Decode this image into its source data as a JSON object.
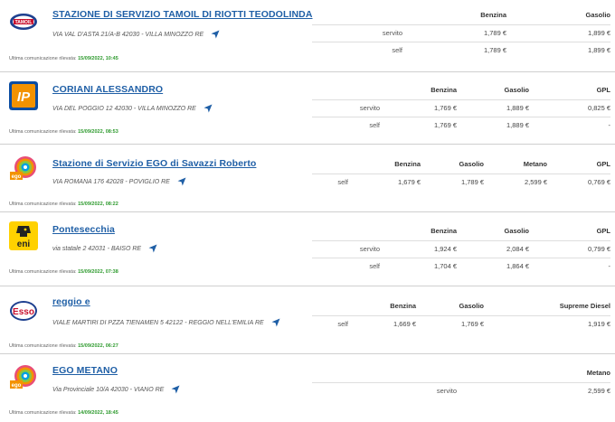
{
  "labels": {
    "last_update": "Ultima comunicazione rilevata:"
  },
  "stations": [
    {
      "name": "STAZIONE DI SERVIZIO TAMOIL DI RIOTTI TEODOLINDA",
      "address": "VIA VAL D'ASTA 21/A-B 42030 - VILLA MINOZZO RE",
      "brand_icon": "tamoil-logo-icon",
      "last_update": "15/09/2022, 10:45",
      "fuels": [
        "Benzina",
        "Gasolio"
      ],
      "rows": [
        {
          "service": "servito",
          "prices": [
            "1,789 €",
            "1,899 €"
          ]
        },
        {
          "service": "self",
          "prices": [
            "1,789 €",
            "1,899 €"
          ]
        }
      ]
    },
    {
      "name": "CORIANI ALESSANDRO",
      "address": "VIA DEL POGGIO 12 42030 - VILLA MINOZZO RE",
      "brand_icon": "ip-logo-icon",
      "last_update": "15/09/2022, 08:53",
      "fuels": [
        "Benzina",
        "Gasolio",
        "GPL"
      ],
      "rows": [
        {
          "service": "servito",
          "prices": [
            "1,769 €",
            "1,889 €",
            "0,825 €"
          ]
        },
        {
          "service": "self",
          "prices": [
            "1,769 €",
            "1,889 €",
            "-"
          ]
        }
      ]
    },
    {
      "name": "Stazione di Servizio EGO di Savazzi Roberto",
      "address": "VIA ROMANA 176 42028 - POVIGLIO RE",
      "brand_icon": "ego-logo-icon",
      "last_update": "15/09/2022, 08:22",
      "fuels": [
        "Benzina",
        "Gasolio",
        "Metano",
        "GPL"
      ],
      "rows": [
        {
          "service": "self",
          "prices": [
            "1,679 €",
            "1,789 €",
            "2,599 €",
            "0,769 €"
          ]
        }
      ]
    },
    {
      "name": "Pontesecchia",
      "address": "via statale 2 42031 - BAISO RE",
      "brand_icon": "eni-logo-icon",
      "last_update": "15/09/2022, 07:38",
      "fuels": [
        "Benzina",
        "Gasolio",
        "GPL"
      ],
      "rows": [
        {
          "service": "servito",
          "prices": [
            "1,924 €",
            "2,084 €",
            "0,799 €"
          ]
        },
        {
          "service": "self",
          "prices": [
            "1,704 €",
            "1,864 €",
            "-"
          ]
        }
      ]
    },
    {
      "name": "reggio e",
      "address": "VIALE MARTIRI DI PZZA TIENAMEN 5 42122 - REGGIO NELL'EMILIA RE",
      "brand_icon": "esso-logo-icon",
      "last_update": "15/09/2022, 06:27",
      "fuels": [
        "Benzina",
        "Gasolio",
        "Supreme Diesel"
      ],
      "rows": [
        {
          "service": "self",
          "prices": [
            "1,669 €",
            "1,769 €",
            "1,919 €"
          ]
        }
      ]
    },
    {
      "name": "EGO METANO",
      "address": "Via Provinciale 10/A 42030 - VIANO RE",
      "brand_icon": "ego-logo-icon",
      "last_update": "14/09/2022, 18:45",
      "fuels": [
        "Metano"
      ],
      "rows": [
        {
          "service": "servito",
          "prices": [
            "2,599 €"
          ]
        }
      ]
    }
  ]
}
